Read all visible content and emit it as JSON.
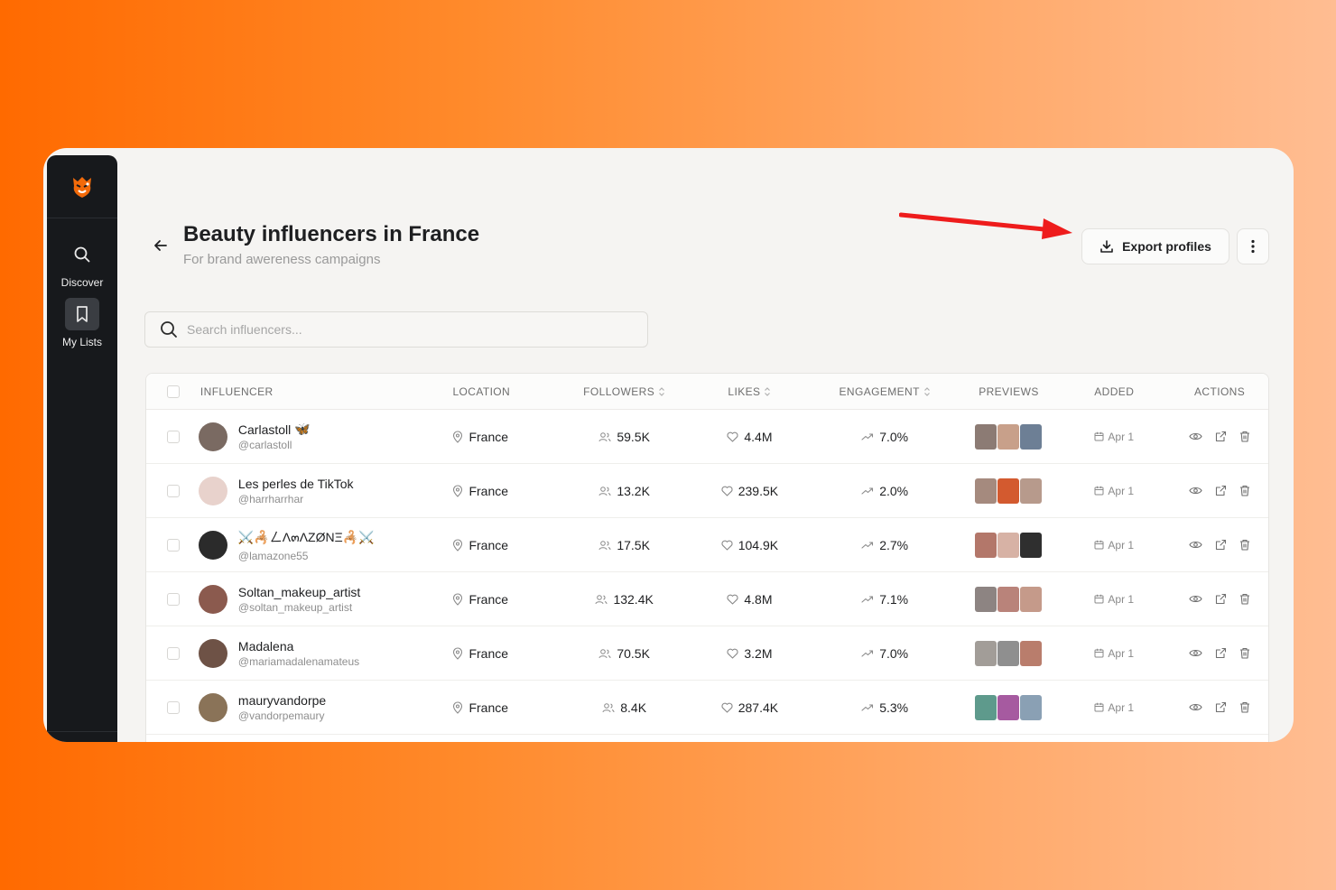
{
  "sidebar": {
    "items": [
      {
        "label": "Discover",
        "icon": "search-icon"
      },
      {
        "label": "My Lists",
        "icon": "bookmark-icon"
      }
    ]
  },
  "header": {
    "title": "Beauty influencers in France",
    "subtitle": "For brand awereness campaigns",
    "export_label": "Export profiles"
  },
  "search": {
    "placeholder": "Search influencers..."
  },
  "table": {
    "columns": {
      "influencer": "INFLUENCER",
      "location": "LOCATION",
      "followers": "FOLLOWERS",
      "likes": "LIKES",
      "engagement": "ENGAGEMENT",
      "previews": "PREVIEWS",
      "added": "ADDED",
      "actions": "ACTIONS"
    },
    "rows": [
      {
        "name": "Carlastoll",
        "badge": "🦋",
        "handle": "@carlastoll",
        "location": "France",
        "followers": "59.5K",
        "likes": "4.4M",
        "engagement": "7.0%",
        "added": "Apr 1",
        "avatar_color": "#7a6a62",
        "thumbs": [
          "#8c7b74",
          "#c8a08a",
          "#6d7f95"
        ]
      },
      {
        "name": "Les perles de TikTok",
        "badge": "",
        "handle": "@harrharrhar",
        "location": "France",
        "followers": "13.2K",
        "likes": "239.5K",
        "engagement": "2.0%",
        "added": "Apr 1",
        "avatar_color": "#e8d2cc",
        "thumbs": [
          "#a58a7e",
          "#d35a2f",
          "#b79a8c"
        ]
      },
      {
        "name": "⚔️🦂ㄥΛ๓ΛΖØΝΞ🦂⚔️",
        "badge": "",
        "handle": "@lamazone55",
        "location": "France",
        "followers": "17.5K",
        "likes": "104.9K",
        "engagement": "2.7%",
        "added": "Apr 1",
        "avatar_color": "#2b2b2b",
        "thumbs": [
          "#b3776a",
          "#d7b2a5",
          "#2f2f2f"
        ]
      },
      {
        "name": "Soltan_makeup_artist",
        "badge": "",
        "handle": "@soltan_makeup_artist",
        "location": "France",
        "followers": "132.4K",
        "likes": "4.8M",
        "engagement": "7.1%",
        "added": "Apr 1",
        "avatar_color": "#8b5a4e",
        "thumbs": [
          "#8d8482",
          "#b9837a",
          "#c59a8a"
        ]
      },
      {
        "name": "Madalena",
        "badge": "",
        "handle": "@mariamadalenamateus",
        "location": "France",
        "followers": "70.5K",
        "likes": "3.2M",
        "engagement": "7.0%",
        "added": "Apr 1",
        "avatar_color": "#6e5246",
        "thumbs": [
          "#a29d98",
          "#8f8f8f",
          "#b97d6c"
        ]
      },
      {
        "name": "mauryvandorpe",
        "badge": "",
        "handle": "@vandorpemaury",
        "location": "France",
        "followers": "8.4K",
        "likes": "287.4K",
        "engagement": "5.3%",
        "added": "Apr 1",
        "avatar_color": "#8a7358",
        "thumbs": [
          "#5e9a8c",
          "#a65aa0",
          "#8aa0b4"
        ]
      }
    ]
  },
  "colors": {
    "accent_arrow": "#ee1c1c",
    "sidebar_bg": "#17191c",
    "text_primary": "#1e1f21"
  }
}
